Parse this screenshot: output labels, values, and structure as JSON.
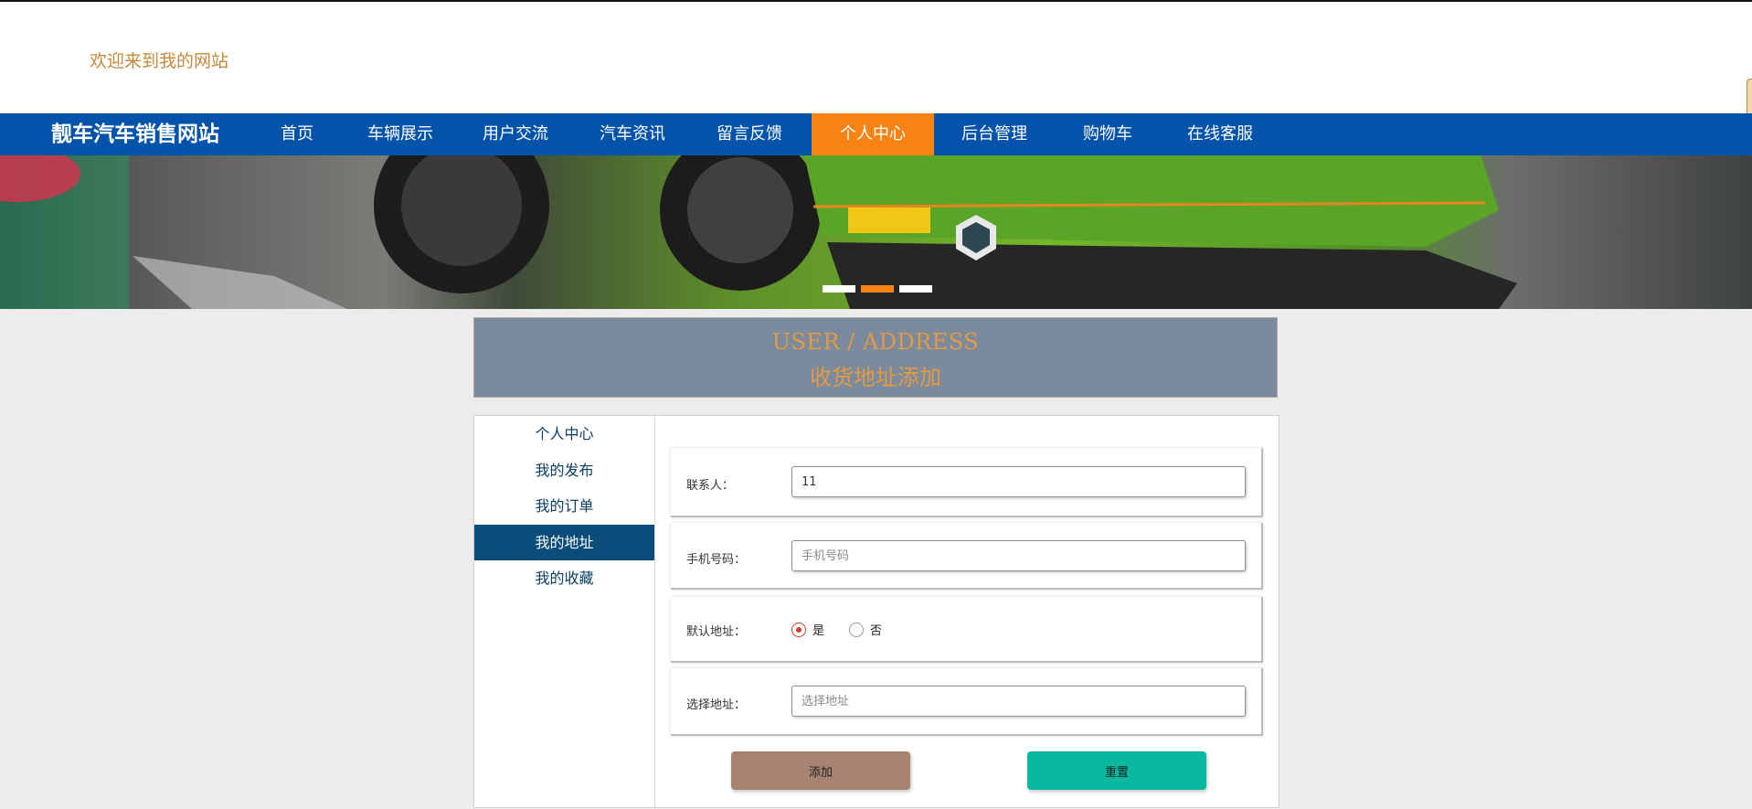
{
  "welcome": "欢迎来到我的网站",
  "nav": {
    "brand": "靓车汽车销售网站",
    "items": [
      {
        "label": "首页",
        "active": false
      },
      {
        "label": "车辆展示",
        "active": false
      },
      {
        "label": "用户交流",
        "active": false
      },
      {
        "label": "汽车资讯",
        "active": false
      },
      {
        "label": "留言反馈",
        "active": false
      },
      {
        "label": "个人中心",
        "active": true
      },
      {
        "label": "后台管理",
        "active": false
      },
      {
        "label": "购物车",
        "active": false
      },
      {
        "label": "在线客服",
        "active": false
      }
    ]
  },
  "banner": {
    "image": "green-race-car-banner",
    "active_dot": 1,
    "dot_count": 3
  },
  "header": {
    "title_en": "USER / ADDRESS",
    "title_cn": "收货地址添加"
  },
  "sidebar": {
    "items": [
      {
        "label": "个人中心",
        "active": false
      },
      {
        "label": "我的发布",
        "active": false
      },
      {
        "label": "我的订单",
        "active": false
      },
      {
        "label": "我的地址",
        "active": true
      },
      {
        "label": "我的收藏",
        "active": false
      }
    ]
  },
  "form": {
    "contact": {
      "label": "联系人：",
      "value": "11",
      "placeholder": ""
    },
    "phone": {
      "label": "手机号码：",
      "value": "",
      "placeholder": "手机号码"
    },
    "default": {
      "label": "默认地址：",
      "options": [
        "是",
        "否"
      ],
      "selected": "是"
    },
    "address": {
      "label": "选择地址：",
      "value": "",
      "placeholder": "选择地址"
    }
  },
  "buttons": {
    "add": "添加",
    "reset": "重置"
  },
  "colors": {
    "nav": "#0353aa",
    "active_nav": "#f78314",
    "sidebar_active": "#0a4c7a",
    "add_button": "#a78472",
    "reset_button": "#08b9a0",
    "header_bg": "#7b8a9d",
    "header_text": "#e39a44"
  }
}
